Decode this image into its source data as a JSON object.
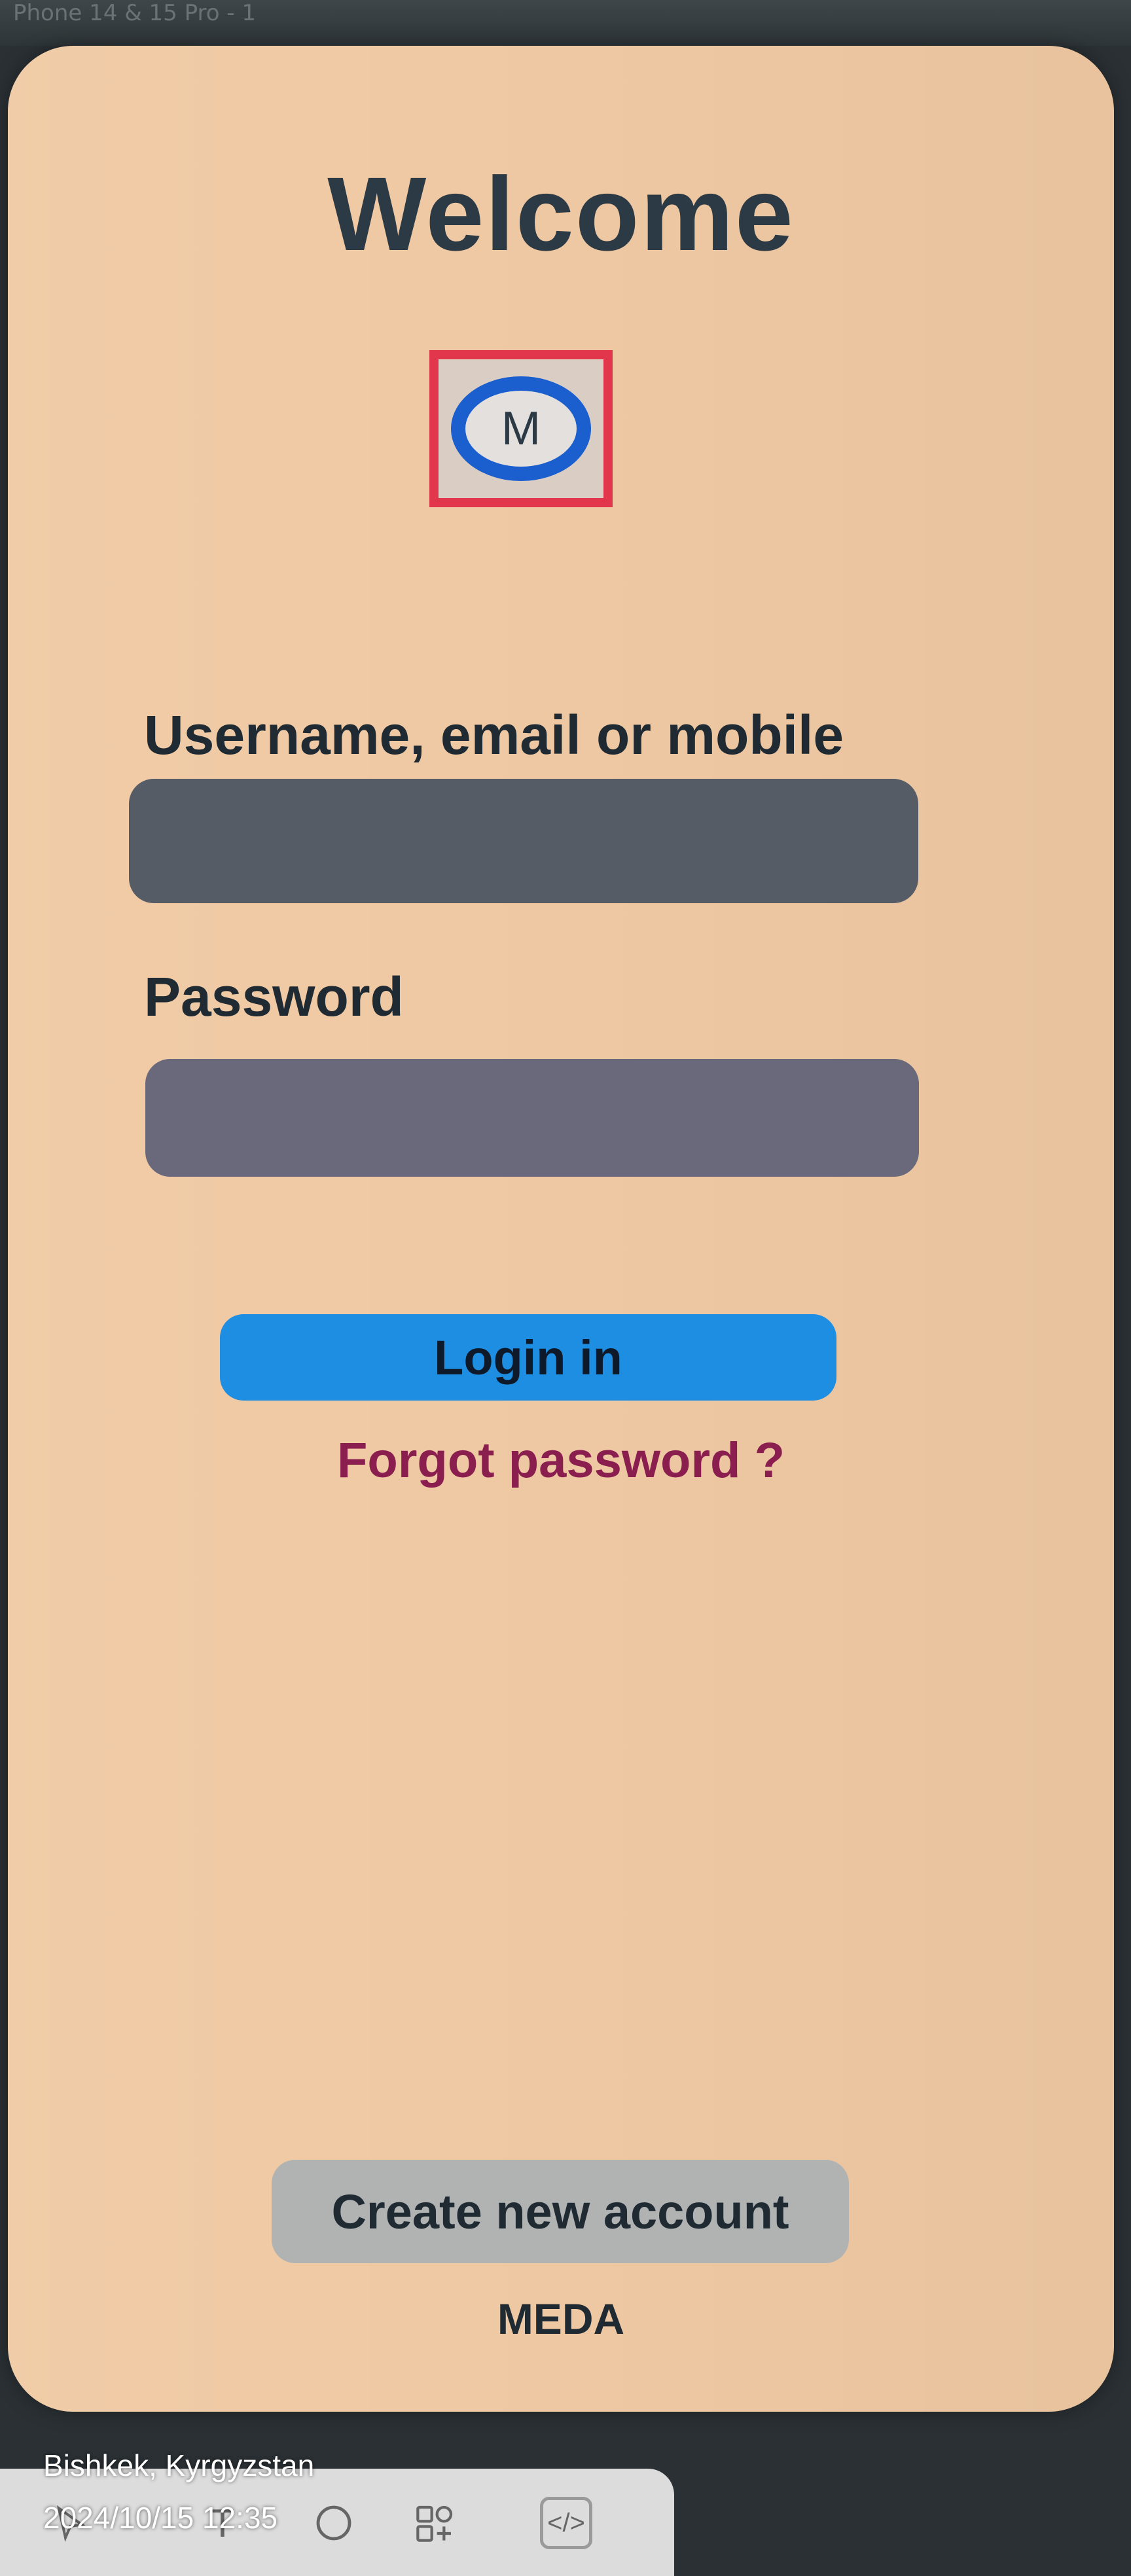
{
  "status_bar": {
    "text": "Phone 14 & 15 Pro - 1"
  },
  "screen": {
    "title": "Welcome",
    "logo_letter": "M",
    "username_label": "Username, email or  mobile",
    "username_value": "",
    "password_label": "Password",
    "password_value": "",
    "login_button": "Login in",
    "forgot_link": "Forgot password ?",
    "create_account_button": "Create new account",
    "brand": "MEDA"
  },
  "dock": {
    "icons": [
      "cursor-icon",
      "text-icon",
      "shape-icon",
      "components-icon",
      "code-icon"
    ],
    "text_glyph": "T",
    "code_glyph": "</>"
  },
  "watermark": {
    "location": "Bishkek, Kyrgyzstan",
    "datetime": "2024/10/15 12:35"
  },
  "colors": {
    "screen_bg": "#efc9a3",
    "title": "#2b3a45",
    "login_button": "#1e8ee3",
    "forgot_link": "#8a1f4f",
    "logo_frame": "#e1364c",
    "logo_ring": "#1b5fcf"
  }
}
